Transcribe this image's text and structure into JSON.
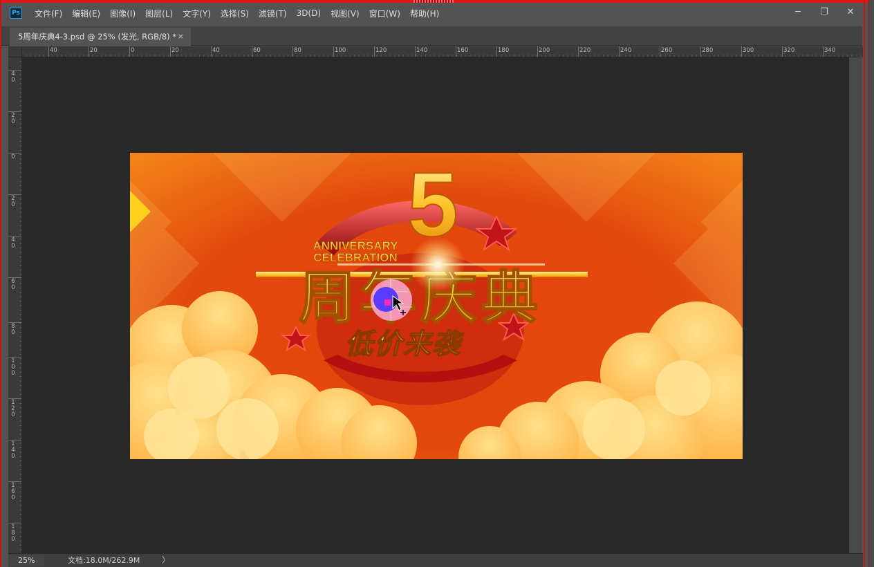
{
  "app": {
    "logo_text": "Ps"
  },
  "menu": [
    "文件(F)",
    "编辑(E)",
    "图像(I)",
    "图层(L)",
    "文字(Y)",
    "选择(S)",
    "滤镜(T)",
    "3D(D)",
    "视图(V)",
    "窗口(W)",
    "帮助(H)"
  ],
  "window_controls": {
    "minimize": "─",
    "restore": "❐",
    "close": "✕"
  },
  "document_tab": {
    "title": "5周年庆典4-3.psd @ 25% (发光, RGB/8) *",
    "close": "×"
  },
  "ruler": {
    "h_labels": [
      "40",
      "20",
      "0",
      "20",
      "40",
      "60",
      "80",
      "100",
      "120",
      "140",
      "160",
      "180",
      "200",
      "220",
      "240",
      "260",
      "280",
      "300",
      "320",
      "340"
    ],
    "v_labels": [
      "40",
      "20",
      "0",
      "20",
      "40",
      "60",
      "80",
      "100",
      "120",
      "140",
      "160",
      "180"
    ]
  },
  "artwork": {
    "headline_en_line1": "ANNIVERSARY",
    "headline_en_line2": "CELEBRATION",
    "big_number": "5",
    "title_cn": "周年庆典",
    "subtitle_cn": "低价来袭"
  },
  "status": {
    "zoom": "25%",
    "doc_info": "文档:18.0M/262.9M",
    "arrow": "〉"
  },
  "colors": {
    "bg": "#535353",
    "pasteboard": "#282828",
    "frame_red": "#e11414",
    "gold": "#ffc93a",
    "orange_bg": "#f26a10"
  }
}
